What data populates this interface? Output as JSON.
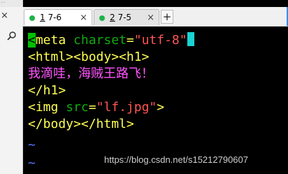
{
  "left_pane": {
    "top_text": "...",
    "close_glyph": "×",
    "search_icon": "search-icon"
  },
  "tabs": [
    {
      "index": "1",
      "label": "7-6",
      "active": true,
      "close": "×",
      "status_color": "#1fb34a"
    },
    {
      "index": "2",
      "label": "7-5",
      "active": false,
      "close": "×",
      "status_color": "#1fb34a"
    }
  ],
  "new_tab_label": "+",
  "editor": {
    "line1": {
      "first_char": "<",
      "tag": "meta",
      "attr": "charset",
      "eq": "=",
      "value": "\"utf-8\""
    },
    "line2": "<html><body><h1>",
    "line3": "我滴哇，海贼王路飞！",
    "line4": "</h1>",
    "line5": {
      "tag_open": "<img",
      "attr": "src",
      "eq": "=",
      "value": "\"lf.jpg\"",
      "tag_close": ">"
    },
    "line6": "</body></html>",
    "tilde": "~"
  },
  "watermark": "https://blog.csdn.net/s15212790607",
  "colors": {
    "tag": "#ffff55",
    "attr": "#11aa11",
    "string": "#ff5555",
    "text": "#ff55ff",
    "tilde": "#5577ff",
    "cursor": "#19d3d3"
  }
}
